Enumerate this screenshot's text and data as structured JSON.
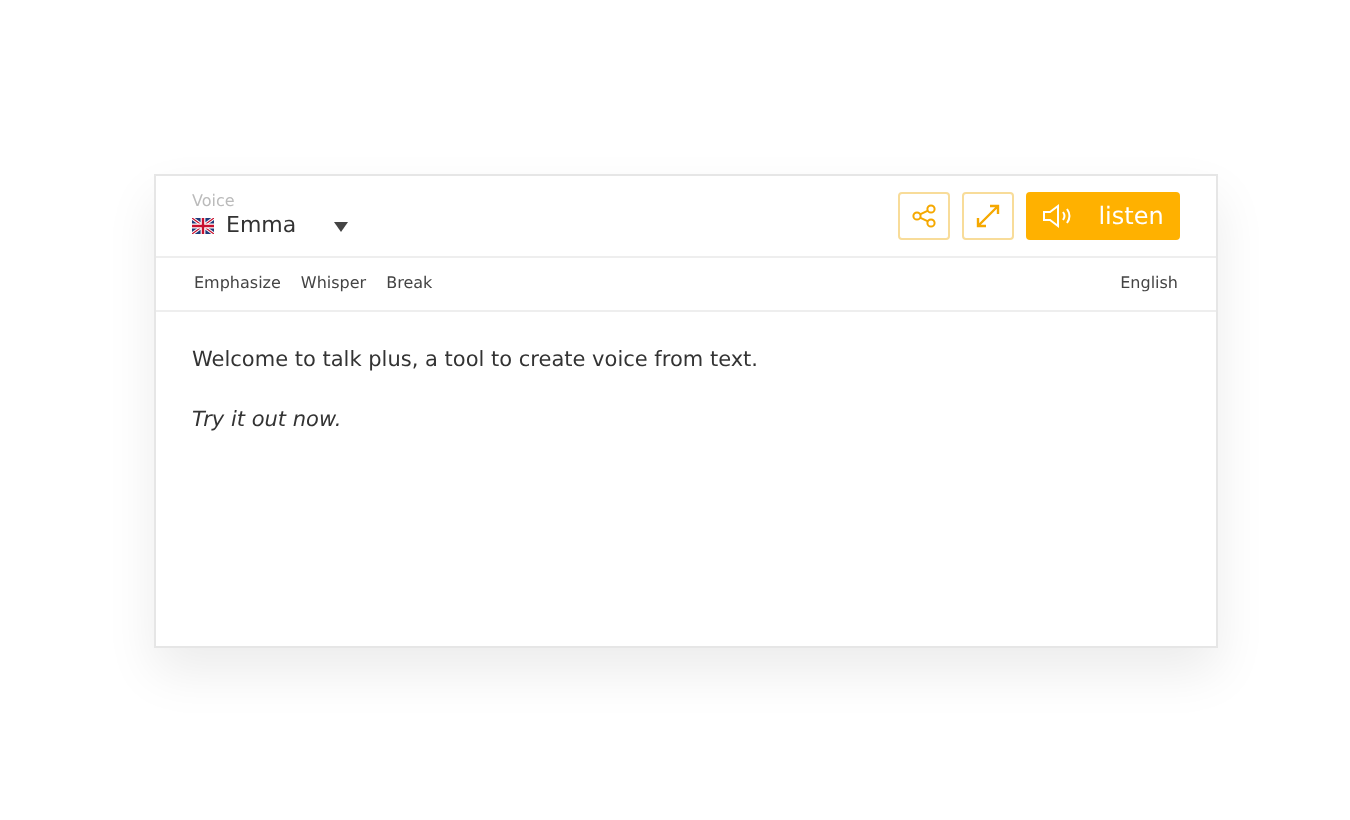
{
  "voice": {
    "label": "Voice",
    "value": "Emma"
  },
  "actions": {
    "listen": "listen"
  },
  "toolbar": {
    "items": [
      "Emphasize",
      "Whisper",
      "Break"
    ],
    "language": "English"
  },
  "editor": {
    "paragraphs": [
      {
        "text": "Welcome to talk plus, a tool to create voice from text.",
        "italic": false
      },
      {
        "text": "Try it out now.",
        "italic": true
      }
    ]
  }
}
